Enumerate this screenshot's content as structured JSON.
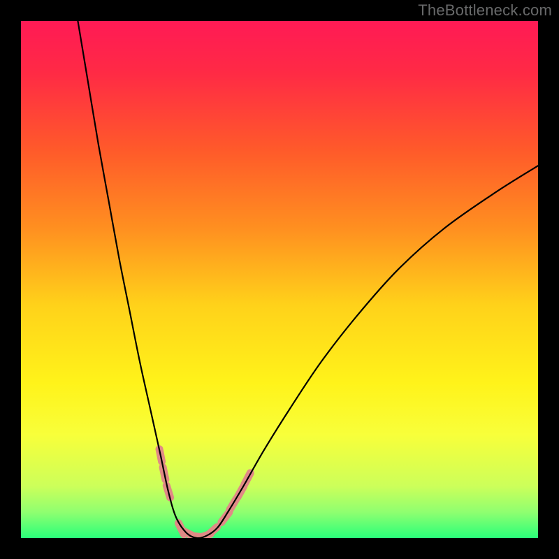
{
  "watermark": "TheBottleneck.com",
  "chart_data": {
    "type": "line",
    "title": "",
    "xlabel": "",
    "ylabel": "",
    "xlim": [
      0,
      100
    ],
    "ylim": [
      0,
      100
    ],
    "grid": false,
    "legend": false,
    "gradient_stops": [
      {
        "offset": 0.0,
        "color": "#ff1a55"
      },
      {
        "offset": 0.1,
        "color": "#ff2a45"
      },
      {
        "offset": 0.25,
        "color": "#ff5a2a"
      },
      {
        "offset": 0.4,
        "color": "#ff8f20"
      },
      {
        "offset": 0.55,
        "color": "#ffd21a"
      },
      {
        "offset": 0.7,
        "color": "#fff31a"
      },
      {
        "offset": 0.8,
        "color": "#f8ff3a"
      },
      {
        "offset": 0.9,
        "color": "#ccff5a"
      },
      {
        "offset": 0.95,
        "color": "#8fff70"
      },
      {
        "offset": 1.0,
        "color": "#2aff7a"
      }
    ],
    "series": [
      {
        "name": "bottleneck-curve",
        "color": "#000000",
        "width": 2.2,
        "x": [
          11,
          13,
          15,
          17,
          19,
          21,
          23,
          25,
          27,
          28.5,
          30,
          32,
          34,
          36,
          38,
          40,
          43,
          47,
          52,
          58,
          65,
          73,
          82,
          92,
          100
        ],
        "y": [
          100,
          88,
          76,
          65,
          54,
          44,
          34,
          25,
          16,
          9,
          4,
          1,
          0,
          0.5,
          2,
          5,
          10,
          17,
          25,
          34,
          43,
          52,
          60,
          67,
          72
        ]
      }
    ],
    "highlight_segments": [
      {
        "cx": 27.0,
        "cy": 16.0
      },
      {
        "cx": 27.7,
        "cy": 12.5
      },
      {
        "cx": 28.5,
        "cy": 9.0
      },
      {
        "cx": 31.0,
        "cy": 1.8
      },
      {
        "cx": 32.5,
        "cy": 0.8
      },
      {
        "cx": 34.0,
        "cy": 0.3
      },
      {
        "cx": 35.5,
        "cy": 0.4
      },
      {
        "cx": 37.0,
        "cy": 1.3
      },
      {
        "cx": 39.5,
        "cy": 4.0
      },
      {
        "cx": 41.0,
        "cy": 6.5
      },
      {
        "cx": 42.5,
        "cy": 9.0
      },
      {
        "cx": 43.8,
        "cy": 11.5
      }
    ],
    "highlight_style": {
      "stroke": "#e08a86",
      "width": 11,
      "linecap": "round"
    }
  }
}
